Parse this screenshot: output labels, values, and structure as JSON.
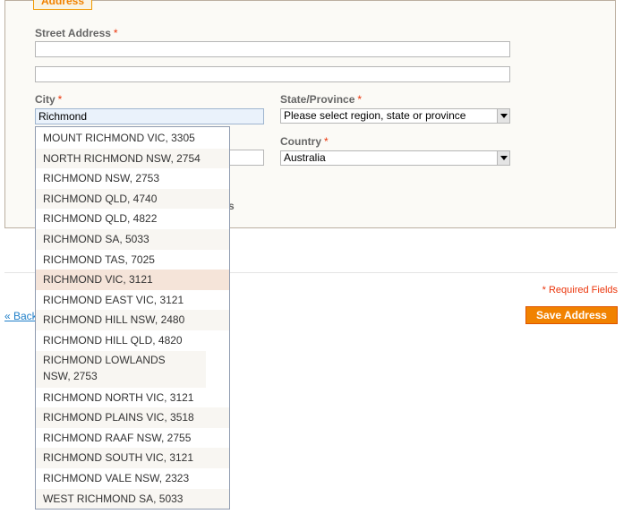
{
  "fieldset": {
    "legend": "Address"
  },
  "street": {
    "label": "Street Address",
    "required_mark": "*",
    "line1_value": "",
    "line2_value": ""
  },
  "city": {
    "label": "City",
    "required_mark": "*",
    "value": "Richmond"
  },
  "state": {
    "label": "State/Province",
    "required_mark": "*",
    "selected": "Please select region, state or province"
  },
  "country": {
    "label": "Country",
    "required_mark": "*",
    "selected": "Australia"
  },
  "hidden_fragment": "s",
  "form": {
    "required_note": "* Required Fields",
    "back_label": "« Back",
    "save_label": "Save Address"
  },
  "suggestions": [
    "MOUNT RICHMOND VIC, 3305",
    "NORTH RICHMOND NSW, 2754",
    "RICHMOND NSW, 2753",
    "RICHMOND QLD, 4740",
    "RICHMOND QLD, 4822",
    "RICHMOND SA, 5033",
    "RICHMOND TAS, 7025",
    "RICHMOND VIC, 3121",
    "RICHMOND EAST VIC, 3121",
    "RICHMOND HILL NSW, 2480",
    "RICHMOND HILL QLD, 4820",
    "RICHMOND LOWLANDS NSW, 2753",
    "RICHMOND NORTH VIC, 3121",
    "RICHMOND PLAINS VIC, 3518",
    "RICHMOND RAAF NSW, 2755",
    "RICHMOND SOUTH VIC, 3121",
    "RICHMOND VALE NSW, 2323",
    "WEST RICHMOND SA, 5033"
  ],
  "highlighted_suggestion": "RICHMOND VIC, 3121"
}
